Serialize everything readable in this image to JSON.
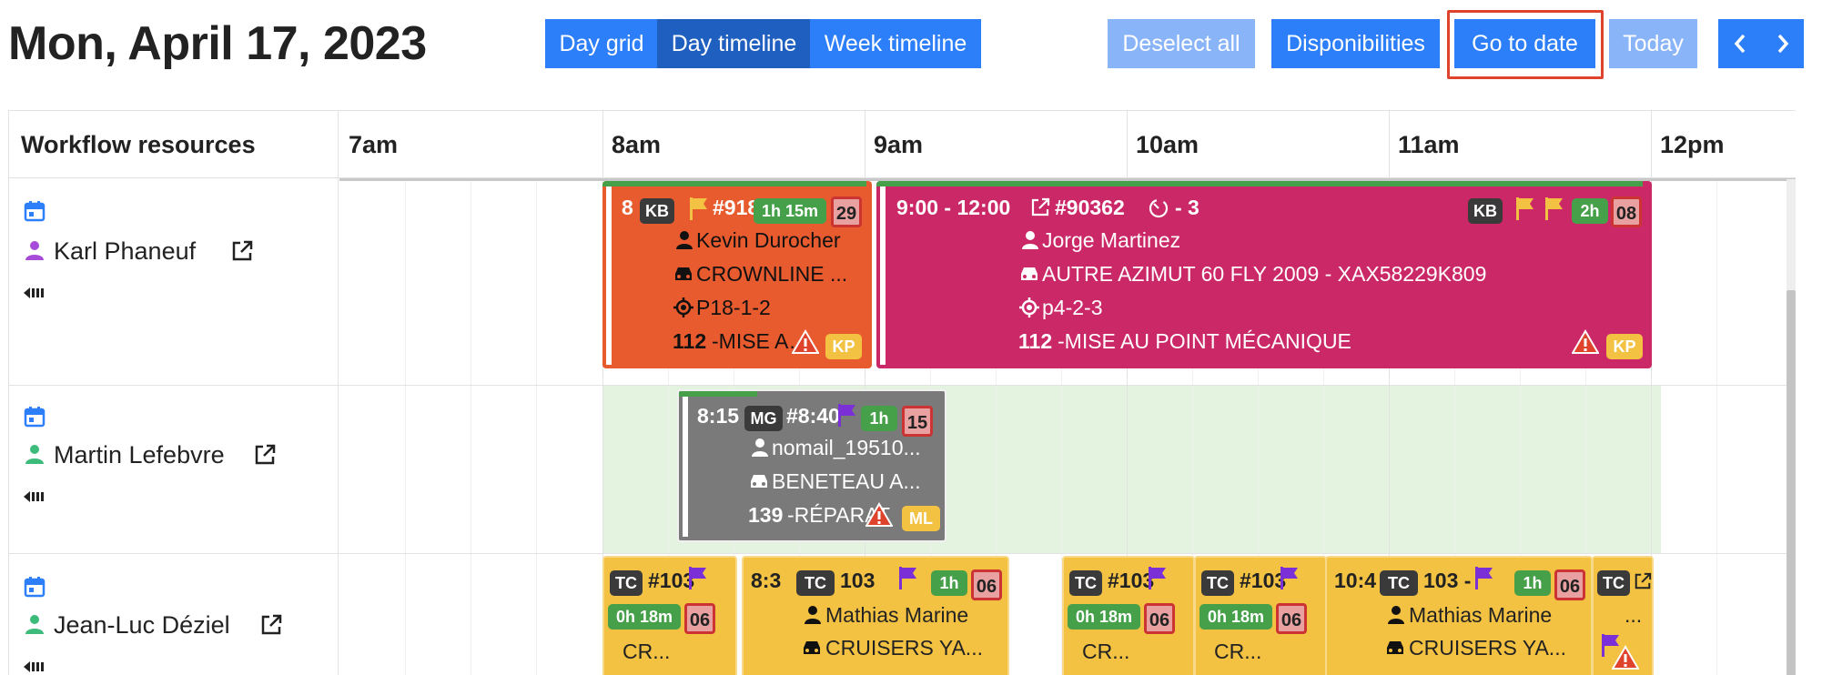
{
  "title": "Mon, April 17, 2023",
  "view_tabs": {
    "day_grid": "Day grid",
    "day_timeline": "Day timeline",
    "week_timeline": "Week timeline"
  },
  "actions": {
    "deselect_all": "Deselect all",
    "disponibilities": "Disponibilities",
    "go_to_date": "Go to date",
    "today": "Today"
  },
  "nav": {
    "prev_icon": "chevron-left-icon",
    "next_icon": "chevron-right-icon"
  },
  "calendar": {
    "resources_header": "Workflow resources",
    "hours": [
      "7am",
      "8am",
      "9am",
      "10am",
      "11am",
      "12pm"
    ],
    "resources": [
      {
        "name": "Karl Phaneuf",
        "person_color": "#a64bd8"
      },
      {
        "name": "Martin Lefebvre",
        "person_color": "#3dbb7a"
      },
      {
        "name": "Jean-Luc Déziel",
        "person_color": "#3dbb7a"
      }
    ]
  },
  "events": {
    "karl_1": {
      "time": "8",
      "id": "#918",
      "initials": "KB",
      "duration": "1h 15m",
      "day": "29",
      "person": "Kevin Durocher",
      "boat": "CROWNLINE ...",
      "location": "P18-1-2",
      "task_code": "112",
      "task": "-MISE AU P",
      "assignee": "KP"
    },
    "karl_2": {
      "time": "9:00 - 12:00",
      "id": "#90362",
      "suffix": "- 3",
      "initials": "KB",
      "duration": "2h",
      "day": "08",
      "person": "Jorge Martinez",
      "boat": "AUTRE AZIMUT 60 FLY 2009 - XAX58229K809",
      "location": "p4-2-3",
      "task_code": "112",
      "task": "-MISE AU POINT MÉCANIQUE",
      "assignee": "KP"
    },
    "martin_1": {
      "time": "8:15",
      "id": "#8:40",
      "initials": "MG",
      "duration": "1h",
      "day": "15",
      "person": "nomail_19510...",
      "boat": "BENETEAU A...",
      "task_code": "139",
      "task": "-RÉPARAT",
      "assignee": "ML"
    },
    "jl": [
      {
        "initials": "TC",
        "id": "#103",
        "duration": "0h 18m",
        "day": "06",
        "line": "CR..."
      },
      {
        "time": "8:3",
        "initials": "TC",
        "id": "103",
        "duration": "1h",
        "day": "06",
        "person": "Mathias Marine",
        "boat": "CRUISERS YA..."
      },
      {
        "initials": "TC",
        "id": "#103",
        "duration": "0h 18m",
        "day": "06",
        "line": "CR..."
      },
      {
        "initials": "TC",
        "id": "#103",
        "duration": "0h 18m",
        "day": "06",
        "line": "CR..."
      },
      {
        "time": "10:4",
        "initials": "TC",
        "id": "103 -",
        "duration": "1h",
        "day": "06",
        "person": "Mathias Marine",
        "boat": "CRUISERS YA..."
      },
      {
        "initials": "TC",
        "line": "..."
      }
    ]
  },
  "colors": {
    "primary": "#2d7ff9",
    "active": "#1f5fbf",
    "disabled": "#8ab4f8",
    "highlight": "#e0432b",
    "orange": "#e85b2e",
    "magenta": "#cb2868",
    "gray": "#7a7a7a",
    "yellow": "#f3c243",
    "available": "#e4f3df"
  }
}
